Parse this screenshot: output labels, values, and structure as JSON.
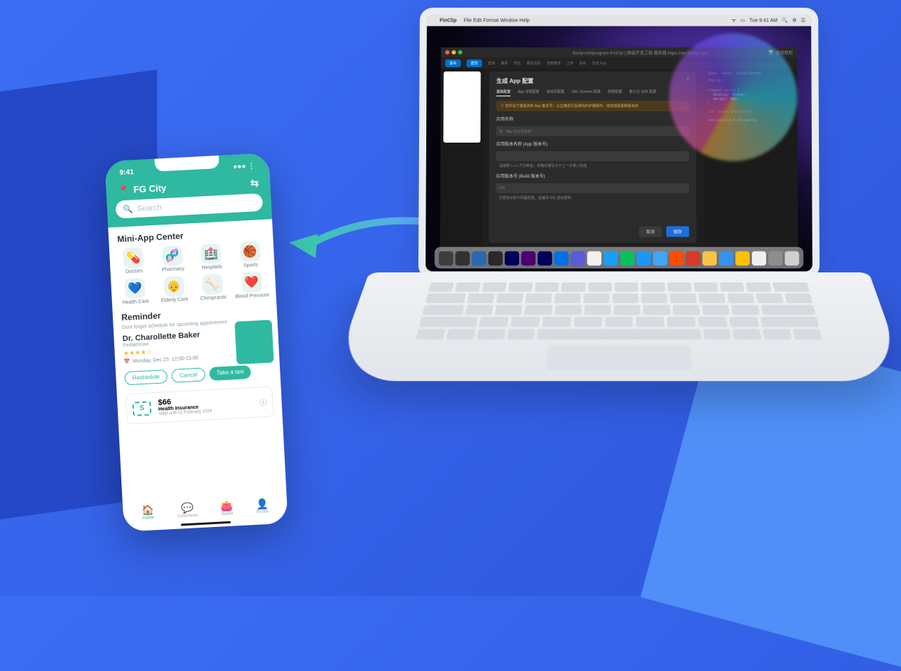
{
  "phone": {
    "status_time": "9:41",
    "location": "FG City",
    "search_placeholder": "Search",
    "mini_app_title": "Mini-App Center",
    "apps": [
      {
        "label": "Doctors",
        "emoji": "💊"
      },
      {
        "label": "Pharmacy",
        "emoji": "🧬"
      },
      {
        "label": "Hospitals",
        "emoji": "🏥"
      },
      {
        "label": "Sports",
        "emoji": "🏀"
      },
      {
        "label": "Health Care",
        "emoji": "💙"
      },
      {
        "label": "Elderly Care",
        "emoji": "👴"
      },
      {
        "label": "Chiropractic",
        "emoji": "🦴"
      },
      {
        "label": "Blood Pressure",
        "emoji": "❤️"
      }
    ],
    "reminder_title": "Reminder",
    "reminder_sub": "Dont forget schedule for upcoming appointment",
    "doctor": {
      "name": "Dr. Charollette Baker",
      "spec": "Pediatrician",
      "date": "Monday, Dec 23",
      "time": "12:00-13:00"
    },
    "actions": {
      "reschedule": "Reshedule",
      "cancel": "Cancel",
      "taxi": "Take a taxi"
    },
    "price_card": {
      "amount": "$66",
      "label": "Health Insurance",
      "sub": "Valid until 01 February 2024"
    },
    "nav": [
      {
        "label": "Home"
      },
      {
        "label": "Comments"
      },
      {
        "label": "Wallet"
      },
      {
        "label": "Profile"
      }
    ]
  },
  "mac": {
    "menubar": {
      "app": "FinClip",
      "items": [
        "File",
        "Edit",
        "Format",
        "Window",
        "Help"
      ],
      "time": "Tue 9:41 AM"
    },
    "ide": {
      "title": "finclip-miniprogram-FinClip | 跨端开发工具 服务器 https://api.finclip.com",
      "trophy_label": "使用帮助",
      "toolbar": [
        "基本",
        "首页",
        "登录",
        "编译",
        "预览",
        "真机调试",
        "清除缓存",
        "上传",
        "发布",
        "生成 App"
      ]
    },
    "dialog": {
      "title": "生成 App 配置",
      "tabs": [
        "基础配置",
        "App 详情配置",
        "启动页配置",
        "URL Scheme 配置",
        "权限配置",
        "第三方 SDK 配置"
      ],
      "warning": "① 您并没下载需求的 App 集本号，以正确进行后续的的步骤操作，动态获取更新版本的",
      "field1_label": "应用名称",
      "field1_placeholder": "如：App 的正式名称",
      "field2_label": "应用版本名称 (App 版本号)",
      "field2_hint": "请按照 x.x.x 方式命名，并确切填写大于上一次录入的值",
      "field3_label": "应用版本号 (Build 版本号)",
      "field3_value": "100",
      "field3_hint": "方便加识别不同版配置，后编译 IDE 自动更新",
      "btn_cancel": "取消",
      "btn_confirm": "保存"
    },
    "devtools": {
      "tabs": [
        "Styles",
        "Layout",
        "Event Listeners"
      ],
      "filter": ":hov  .cls  +",
      "rule1": "element.style {",
      "rule2": "display: block;",
      "rule3": "margin: 0px;",
      "rule4": "}",
      "rule5": "webview/116.4.chrome:18",
      "agent": "user agent stylesheet"
    },
    "dock_colors": [
      "#3d3d3d",
      "#313131",
      "#2a69b0",
      "#292929",
      "#00005b",
      "#4b006e",
      "#00005b",
      "#0071e3",
      "#5b5bd6",
      "#f1f1f1",
      "#1c9cf6",
      "#07c160",
      "#1b98f5",
      "#42a5f5",
      "#ff4c00",
      "#d73a28",
      "#f6c445",
      "#3792ef",
      "#ffc107",
      "#efefef",
      "#8e8e8e",
      "#cfcfcf"
    ]
  }
}
